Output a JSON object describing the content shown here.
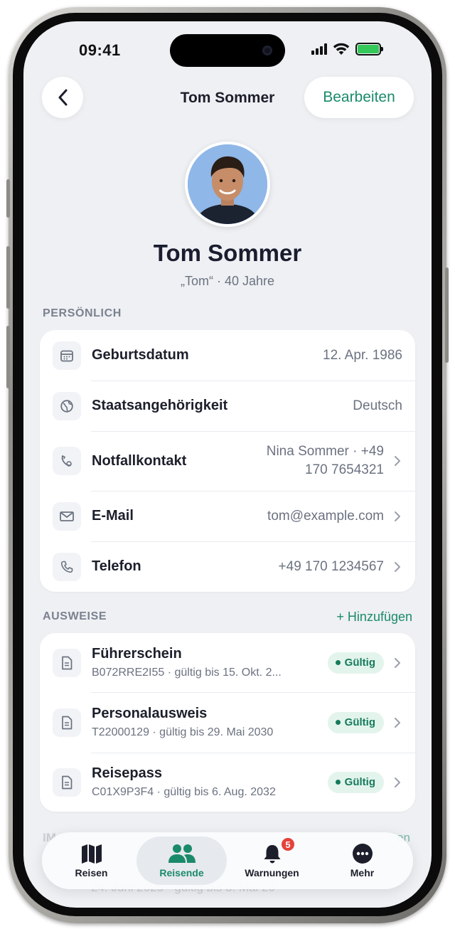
{
  "status_bar": {
    "time": "09:41"
  },
  "nav": {
    "title": "Tom Sommer",
    "edit_label": "Bearbeiten"
  },
  "profile": {
    "name": "Tom Sommer",
    "subtitle": "„Tom“ · 40 Jahre"
  },
  "personal": {
    "section_label": "PERSÖNLICH",
    "rows": [
      {
        "icon": "calendar-icon",
        "label": "Geburtsdatum",
        "value": "12. Apr. 1986"
      },
      {
        "icon": "globe-icon",
        "label": "Staatsangehörigkeit",
        "value": "Deutsch"
      },
      {
        "icon": "emergency-contact-icon",
        "label": "Notfallkontakt",
        "value_line1": "Nina Sommer · +49",
        "value_line2": "170 7654321"
      },
      {
        "icon": "mail-icon",
        "label": "E-Mail",
        "value": "tom@example.com"
      },
      {
        "icon": "phone-icon",
        "label": "Telefon",
        "value": "+49 170 1234567"
      }
    ]
  },
  "documents": {
    "section_label": "AUSWEISE",
    "add_label": "+ Hinzufügen",
    "items": [
      {
        "title": "Führerschein",
        "subtitle": "B072RRE2I55 · gültig bis 15. Okt. 2...",
        "status": "Gültig"
      },
      {
        "title": "Personalausweis",
        "subtitle": "T22000129 · gültig bis 29. Mai 2030",
        "status": "Gültig"
      },
      {
        "title": "Reisepass",
        "subtitle": "C01X9P3F4 · gültig bis 6. Aug. 2032",
        "status": "Gültig"
      }
    ]
  },
  "partially_hidden": {
    "section_prefix": "IM",
    "action_suffix": "en",
    "row_text": "24. Juni 2025 · gültig bis 3. Mai 20"
  },
  "tabbar": {
    "tabs": [
      {
        "label": "Reisen",
        "icon": "map-icon",
        "active": false
      },
      {
        "label": "Reisende",
        "icon": "people-icon",
        "active": true
      },
      {
        "label": "Warnungen",
        "icon": "bell-icon",
        "active": false,
        "badge": "5"
      },
      {
        "label": "Mehr",
        "icon": "more-icon",
        "active": false
      }
    ]
  },
  "colors": {
    "accent": "#1b8a6b",
    "background": "#eef0f3",
    "badge_red": "#e5423b",
    "valid_bg": "#e3f4ec"
  }
}
